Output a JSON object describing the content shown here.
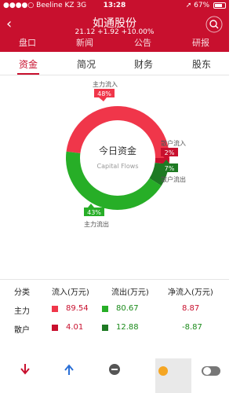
{
  "status_bar": {
    "carrier": "Beeline KZ",
    "network": "3G",
    "time": "13:28",
    "battery_percent": "67%"
  },
  "header": {
    "title": "如通股份",
    "quote": "21.12  +1.92  +10.00%",
    "section_tabs": [
      "盘口",
      "新闻",
      "公告",
      "研报"
    ]
  },
  "sub_tabs": [
    {
      "label": "资金",
      "active": true
    },
    {
      "label": "简况",
      "active": false
    },
    {
      "label": "财务",
      "active": false
    },
    {
      "label": "股东",
      "active": false
    }
  ],
  "chart_data": {
    "type": "pie",
    "title": "今日资金",
    "subtitle": "Capital Flows",
    "slices": [
      {
        "name": "主力流入",
        "percent": 48,
        "color": "#f0364a"
      },
      {
        "name": "散户流入",
        "percent": 2,
        "color": "#c8102e"
      },
      {
        "name": "散户流出",
        "percent": 7,
        "color": "#1e7a23"
      },
      {
        "name": "主力流出",
        "percent": 43,
        "color": "#27ae27"
      }
    ]
  },
  "table": {
    "headers": [
      "分类",
      "流入(万元)",
      "流出(万元)",
      "净流入(万元)"
    ],
    "rows": [
      {
        "category": "主力",
        "inflow": "89.54",
        "outflow": "80.67",
        "net": "8.87",
        "inflow_color": "#f0364a",
        "outflow_color": "#27ae27"
      },
      {
        "category": "散户",
        "inflow": "4.01",
        "outflow": "12.88",
        "net": "-8.87",
        "inflow_color": "#c8102e",
        "outflow_color": "#1e7a23"
      }
    ]
  },
  "colors": {
    "brand": "#c8102e",
    "inflow_text": "#c8102e",
    "outflow_text": "#1a8a1a"
  }
}
